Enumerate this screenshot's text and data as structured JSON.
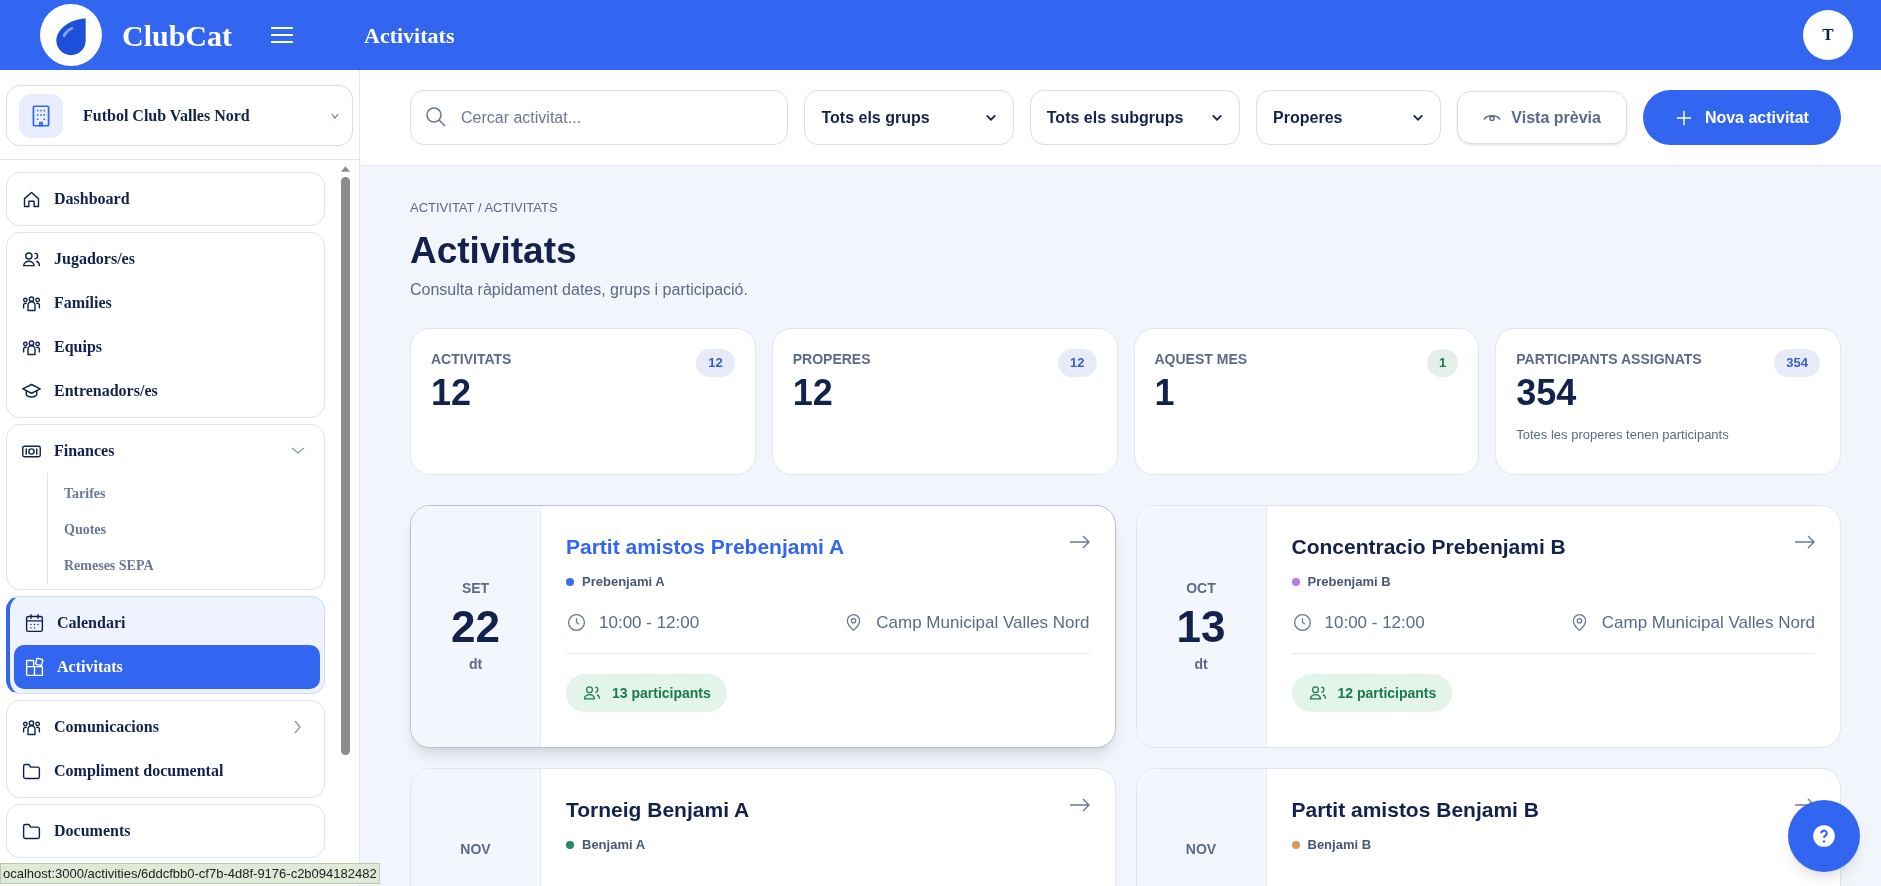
{
  "header": {
    "brand": "ClubCat",
    "page_title": "Activitats",
    "avatar": "T"
  },
  "sidebar": {
    "org": "Futbol Club Valles Nord",
    "groups": [
      {
        "active": false,
        "items": [
          {
            "label": "Dashboard",
            "kind": "home",
            "selected": false
          }
        ]
      },
      {
        "active": false,
        "items": [
          {
            "label": "Jugadors/es",
            "kind": "users",
            "selected": false
          },
          {
            "label": "Famílies",
            "kind": "group",
            "selected": false
          },
          {
            "label": "Equips",
            "kind": "group",
            "selected": false
          },
          {
            "label": "Entrenadors/es",
            "kind": "cap",
            "selected": false
          }
        ]
      },
      {
        "active": false,
        "items": [
          {
            "label": "Finances",
            "kind": "money",
            "selected": false,
            "expanded": true,
            "children": [
              {
                "label": "Tarifes"
              },
              {
                "label": "Quotes"
              },
              {
                "label": "Remeses SEPA"
              }
            ]
          }
        ]
      },
      {
        "active": true,
        "items": [
          {
            "label": "Calendari",
            "kind": "calendar",
            "selected": false
          },
          {
            "label": "Activitats",
            "kind": "blocks",
            "selected": true
          }
        ]
      },
      {
        "active": false,
        "items": [
          {
            "label": "Comunicacions",
            "kind": "group",
            "selected": false,
            "expanded": false
          },
          {
            "label": "Compliment documental",
            "kind": "folder",
            "selected": false
          }
        ]
      },
      {
        "active": false,
        "items": [
          {
            "label": "Documents",
            "kind": "folder",
            "selected": false
          }
        ]
      }
    ]
  },
  "toolbar": {
    "search_placeholder": "Cercar activitat...",
    "filters": [
      "Tots els grups",
      "Tots els subgrups",
      "Properes"
    ],
    "preview_button": "Vista prèvia",
    "new_button": "Nova activitat"
  },
  "breadcrumb": "ACTIVITAT / ACTIVITATS",
  "title": "Activitats",
  "subtitle": "Consulta ràpidament dates, grups i participació.",
  "stats": [
    {
      "label": "ACTIVITATS",
      "badge": "12",
      "value": "12",
      "color": "#3a5bc7"
    },
    {
      "label": "PROPERES",
      "badge": "12",
      "value": "12",
      "color": "#3a5bc7"
    },
    {
      "label": "AQUEST MES",
      "badge": "1",
      "value": "1",
      "color": "#1b7a3e"
    },
    {
      "label": "PARTICIPANTS ASSIGNATS",
      "badge": "354",
      "value": "354",
      "color": "#3a5bc7",
      "note": "Totes les properes tenen participants"
    }
  ],
  "activities": [
    {
      "month": "SET",
      "day": "22",
      "weekday": "dt",
      "title": "Partit amistos Prebenjami A",
      "group": "Prebenjami A",
      "color": "#3b6ef5",
      "time": "10:00 - 12:00",
      "place": "Camp Municipal Valles Nord",
      "participants": "13 participants",
      "selected": true
    },
    {
      "month": "OCT",
      "day": "13",
      "weekday": "dt",
      "title": "Concentracio Prebenjami B",
      "group": "Prebenjami B",
      "color": "#b77ae8",
      "time": "10:00 - 12:00",
      "place": "Camp Municipal Valles Nord",
      "participants": "12 participants",
      "selected": false
    },
    {
      "month": "NOV",
      "title": "Torneig Benjami A",
      "group": "Benjami A",
      "color": "#1e8a6a",
      "selected": false
    },
    {
      "month": "NOV",
      "title": "Partit amistos Benjami B",
      "group": "Benjami B",
      "color": "#d9975a",
      "selected": false
    }
  ],
  "status_url": "ocalhost:3000/activities/6ddcfbb0-cf7b-4d8f-9176-c2b094182482"
}
